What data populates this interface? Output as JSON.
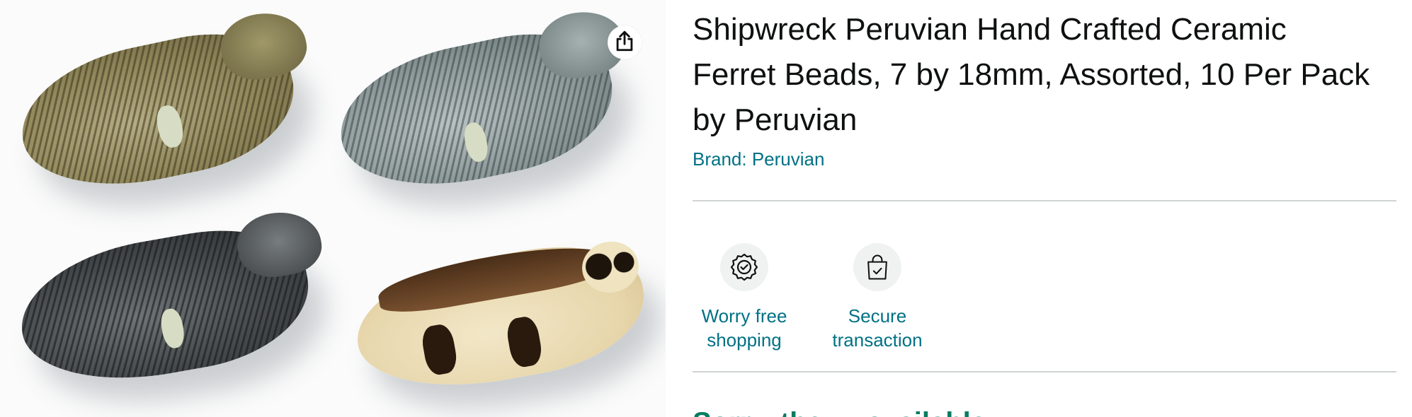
{
  "product": {
    "title": "Shipwreck Peruvian Hand Crafted Ceramic Ferret Beads, 7 by 18mm, Assorted, 10 Per Pack by Peruvian",
    "brand_link": "Brand: Peruvian"
  },
  "image": {
    "share_icon": "share-icon"
  },
  "badges": [
    {
      "icon": "badge-check-icon",
      "label_line1": "Worry free",
      "label_line2": "shopping"
    },
    {
      "icon": "shopping-bag-check-icon",
      "label_line1": "Secure",
      "label_line2": "transaction"
    }
  ],
  "cutoff": {
    "text": "Sorry, the … available"
  },
  "colors": {
    "link": "#007185",
    "divider": "#cfd3d3",
    "text": "#0f1111"
  }
}
